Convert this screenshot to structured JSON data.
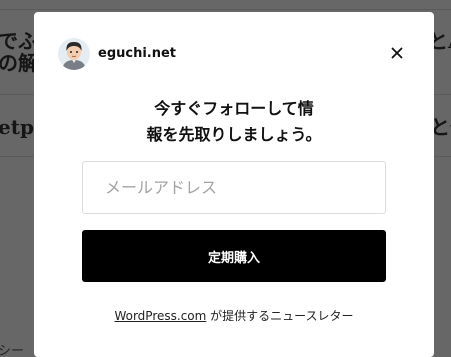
{
  "background": {
    "line1": "でふ",
    "line1_right": "とA",
    "line2": "の解",
    "line3": "etpa",
    "line3_right": "と発",
    "line4": "シー"
  },
  "modal": {
    "site_name": "eguchi.net",
    "headline_line1": "今すぐフォローして情",
    "headline_line2": "報を先取りしましょう。",
    "email_placeholder": "メールアドレス",
    "email_value": "",
    "subscribe_label": "定期購入",
    "footer_link": "WordPress.com",
    "footer_text": " が提供するニュースレター"
  },
  "icons": {
    "avatar": "avatar-icon",
    "close": "close-icon"
  },
  "colors": {
    "overlay": "#000000",
    "button_bg": "#000000",
    "button_text": "#ffffff"
  }
}
